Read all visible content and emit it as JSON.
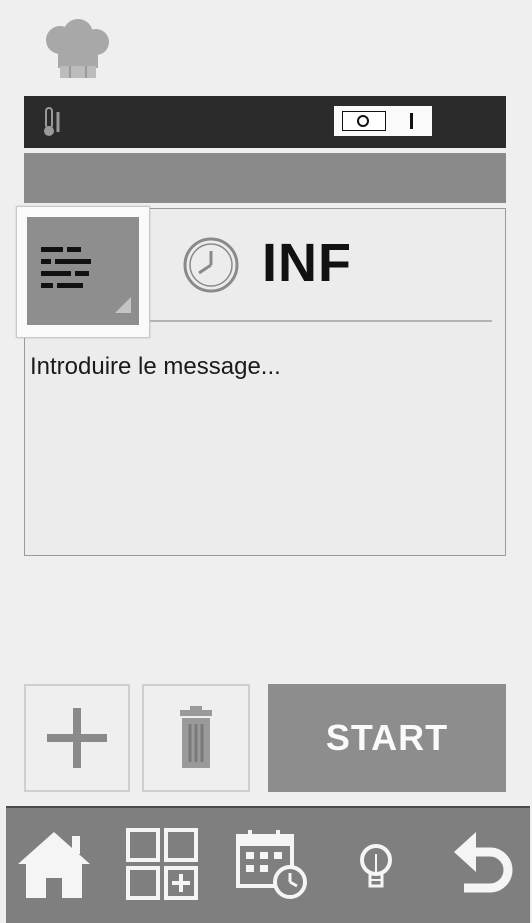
{
  "header": {
    "logo_icon": "chef-hat-icon",
    "thermometer_icon": "thermometer-icon",
    "power_switch_icon": "on-off-switch-icon"
  },
  "message": {
    "mode_icon": "message-lines-icon",
    "time_icon": "clock-icon",
    "duration": "INF",
    "placeholder": "Introduire le message..."
  },
  "actions": {
    "add_icon": "plus-icon",
    "delete_icon": "trash-icon",
    "start_label": "START"
  },
  "nav": {
    "items": [
      {
        "icon": "home-icon"
      },
      {
        "icon": "grid-add-icon"
      },
      {
        "icon": "calendar-clock-icon"
      },
      {
        "icon": "lightbulb-icon"
      },
      {
        "icon": "back-arrow-icon"
      }
    ]
  },
  "colors": {
    "background": "#efefef",
    "header_bar": "#2b2b2b",
    "accent_gray": "#8a8a8a",
    "nav_bar": "#7f7f7f"
  }
}
